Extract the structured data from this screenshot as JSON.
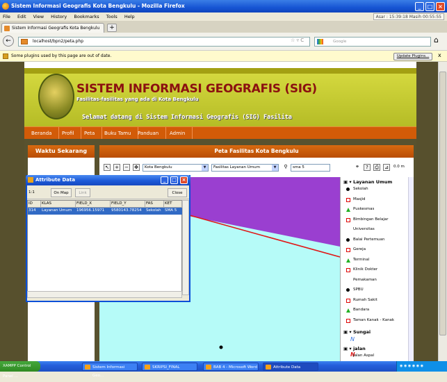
{
  "browser": {
    "title": "Sistem Informasi Geografis Kota Bengkulu - Mozilla Firefox",
    "menu": [
      "File",
      "Edit",
      "View",
      "History",
      "Bookmarks",
      "Tools",
      "Help"
    ],
    "clock": "Asar : 15:39:18  Masih 00:55:55",
    "tab_label": "Sistem Informasi Geografis Kota Bengkulu",
    "new_tab": "+",
    "url": "localhost/bpn2/peta.php",
    "search_placeholder": "Google",
    "notice": "Some plugins used by this page are out of date.",
    "update_button": "Update Plugins...",
    "notice_close": "x"
  },
  "site": {
    "title": "SISTEM INFORMASI GEOGRAFIS (SIG)",
    "subtitle": "Fasilitas-fasilitas yang ada di Kota Bengkulu",
    "welcome": "Selamat datang di Sistem Informasi Geografis (SIG) Fasilita",
    "nav": [
      "Beranda",
      "Profil",
      "Peta",
      "Buku Tamu",
      "Panduan",
      "Admin"
    ],
    "left_heading": "Waktu Sekarang",
    "main_heading": "Peta Fasilitas Kota Bengkulu",
    "map_toolbar": {
      "layer_select": "Kota Bengkulu",
      "theme_select": "Fasilitas Layanan Umum",
      "search_value": "sma 5",
      "scale": "0.0 m"
    }
  },
  "legend": {
    "group1": "Layanan Umum",
    "items1": [
      {
        "label": "Sekolah",
        "sym": "dot"
      },
      {
        "label": "Masjid",
        "sym": "sq"
      },
      {
        "label": "Puskesmas",
        "sym": "tri"
      },
      {
        "label": "Bimbingan Belajar",
        "sym": "sq"
      },
      {
        "label": "Universitas",
        "sym": "none"
      },
      {
        "label": "Balai Pertemuan",
        "sym": "dot"
      },
      {
        "label": "Gereja",
        "sym": "sq"
      },
      {
        "label": "Terminal",
        "sym": "tri"
      },
      {
        "label": "Klinik Dokter",
        "sym": "sq"
      },
      {
        "label": "Pemakaman",
        "sym": "none"
      },
      {
        "label": "SPBU",
        "sym": "dot"
      },
      {
        "label": "Rumah Sakit",
        "sym": "sq"
      },
      {
        "label": "Bandara",
        "sym": "tri"
      },
      {
        "label": "Taman Kanak - Kanak",
        "sym": "sq"
      }
    ],
    "group2": "Sungai",
    "group3": "jalan",
    "jalan_item": "Jalan Aspal",
    "colors": {
      "purple": "#9a3fd0",
      "water": "#b6fbf8",
      "road": "#e01818"
    }
  },
  "attribute_window": {
    "title": "Attribute Data",
    "ratio": "1:1",
    "on_map": "On Map",
    "link": "Link",
    "close": "Close",
    "headers": [
      "ID",
      "KLAS",
      "FIELD_X",
      "FIELD_Y",
      "FAS",
      "KET"
    ],
    "row": [
      "314",
      "Layanan Umum",
      "196956.15971",
      "9580143.78254",
      "Sekolah",
      "SMA 5"
    ]
  },
  "taskbar": {
    "items": [
      "XAMPP Control Panel ...",
      "Sistem Informasi Geo...",
      "SKRIPSI_FINAL",
      "BAB 4 - Microsoft Word",
      "Attribute Data"
    ]
  }
}
